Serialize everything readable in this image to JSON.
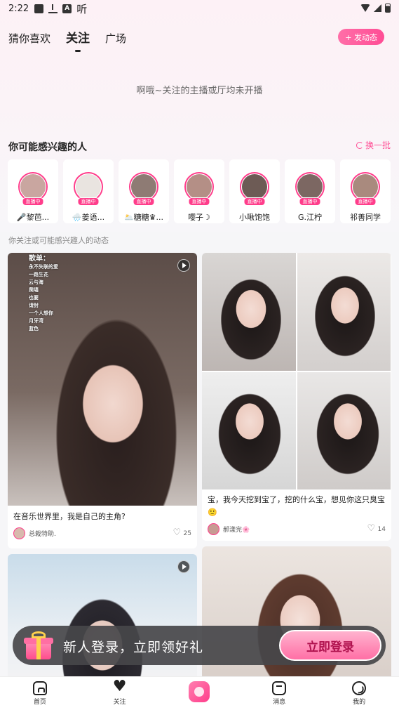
{
  "status_bar": {
    "time": "2:22",
    "app_text": "听"
  },
  "tabs": [
    {
      "label": "猜你喜欢",
      "active": false
    },
    {
      "label": "关注",
      "active": true
    },
    {
      "label": "广场",
      "active": false
    }
  ],
  "post_button": {
    "label": "+ 发动态"
  },
  "empty_message": "啊哦~关注的主播或厅均未开播",
  "recommend": {
    "title": "你可能感兴趣的人",
    "refresh_label": "换一批",
    "live_badge": "直播中",
    "people": [
      {
        "name": "🎤黎芭...",
        "color": "#c9a6a0"
      },
      {
        "name": "🌧️姜语...",
        "color": "#e9e4e0"
      },
      {
        "name": "🌥️糖糖♛...",
        "color": "#8e7b74"
      },
      {
        "name": "嘤子☽",
        "color": "#b48f86"
      },
      {
        "name": "小啾饱饱",
        "color": "#6d5b55"
      },
      {
        "name": "G.江柠",
        "color": "#7c6762"
      },
      {
        "name": "祁善同学",
        "color": "#a98a7e"
      }
    ]
  },
  "feed_label": "你关注或可能感兴趣人的动态",
  "feed": [
    {
      "caption": "在音乐世界里，我是自己的主角?",
      "user": "总栽特助.",
      "likes": "25",
      "songlist_title": "歌单：",
      "songs": [
        "永不失联的爱",
        "一路生花",
        "云与海",
        "爬墙",
        "也要",
        "请封",
        "一个人想你",
        "月牙湾",
        "蓝色"
      ]
    },
    {
      "caption": "宝，我今天挖到宝了，挖的什么宝，想见你这只臭宝🙂",
      "user": "郝漾完🌸",
      "likes": "14"
    },
    {
      "caption": "",
      "user": "",
      "likes": ""
    },
    {
      "caption": "",
      "user": "",
      "likes": ""
    }
  ],
  "promo": {
    "text": "新人登录，立即领好礼",
    "button": "立即登录"
  },
  "bottom_nav": [
    {
      "label": "首页",
      "icon": "home-icon"
    },
    {
      "label": "关注",
      "icon": "heart-icon"
    },
    {
      "label": "",
      "icon": "live-center-icon"
    },
    {
      "label": "消息",
      "icon": "message-icon"
    },
    {
      "label": "我的",
      "icon": "profile-icon"
    }
  ],
  "colors": {
    "accent": "#ff4d95",
    "live": "#ff3d8b"
  }
}
